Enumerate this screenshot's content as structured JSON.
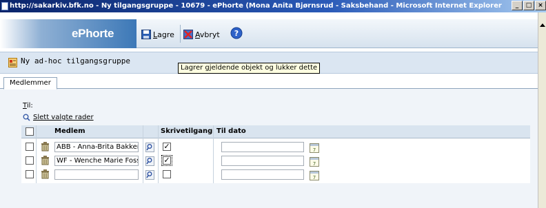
{
  "window": {
    "title": "http://sakarkiv.bfk.no - Ny tilgangsgruppe - 10679 - ePhorte (Mona Anita Bjørnsrud - Saksbehand - Microsoft Internet Explorer",
    "min": "_",
    "max": "□",
    "close": "×"
  },
  "toolbar": {
    "logo": "ePhorte",
    "save_label": "Lagre",
    "cancel_label": "Avbryt"
  },
  "header": {
    "title": "Ny ad-hoc tilgangsgruppe"
  },
  "tooltip": "Lagrer gjeldende objekt og lukker dette",
  "tabs": [
    {
      "label": "Medlemmer"
    }
  ],
  "form": {
    "til_label": "Til:",
    "delete_selected": "Slett valgte rader"
  },
  "grid": {
    "columns": [
      "Medlem",
      "Skrivetilgang",
      "Til dato"
    ],
    "rows": [
      {
        "selected": false,
        "member": "ABB - Anna-Brita Bakker",
        "write_access": true,
        "to_date": ""
      },
      {
        "selected": false,
        "member": "WF - Wenche Marie Foss",
        "write_access": true,
        "to_date": ""
      },
      {
        "selected": false,
        "member": "",
        "write_access": false,
        "to_date": ""
      }
    ]
  },
  "colors": {
    "titlebar": "#0a246a",
    "logo_blue": "#3c78b7",
    "header_bg": "#dbe6f2",
    "tooltip_bg": "#ffffe1"
  }
}
